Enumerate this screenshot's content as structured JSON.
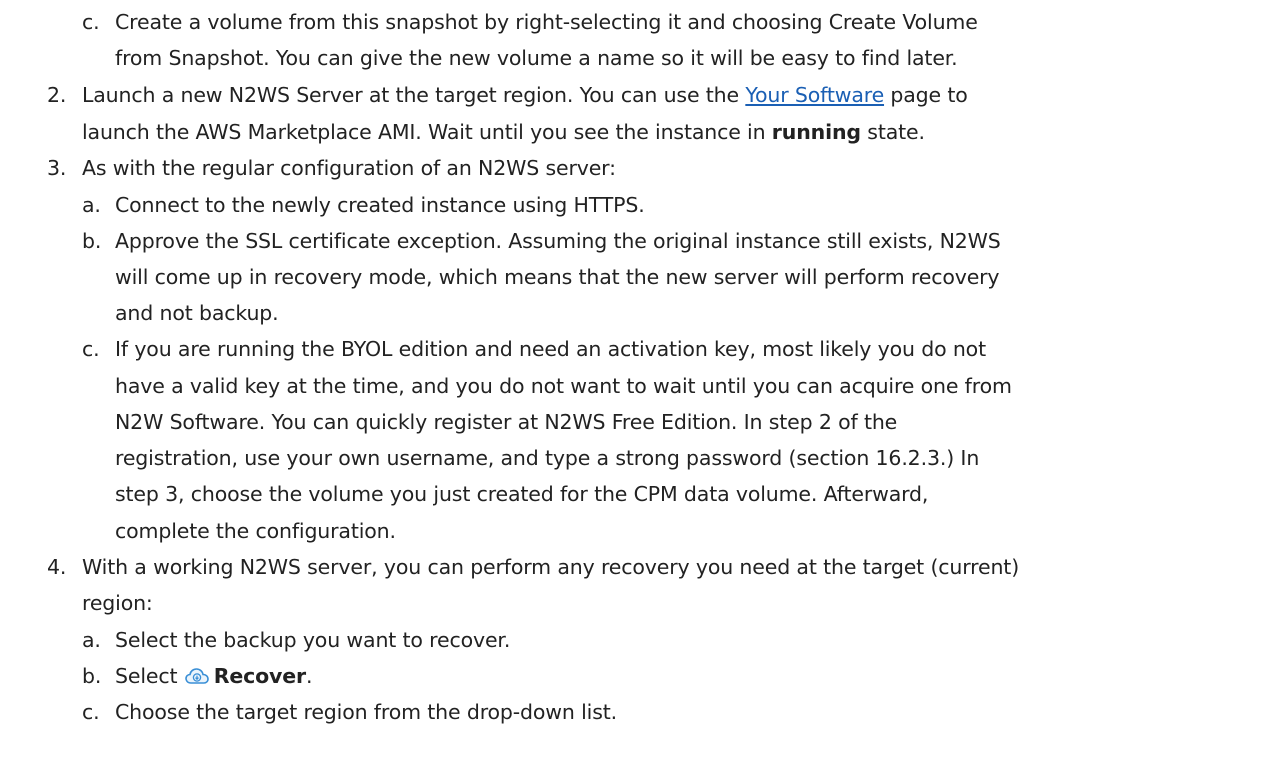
{
  "doc": {
    "item1c": {
      "marker": "c.",
      "line1": "Create a volume from this snapshot by right-selecting it and choosing Create Volume",
      "line2": "from Snapshot. You can give the new volume a name so it will be easy to find later."
    },
    "item2": {
      "marker": "2.",
      "line1_pre": "Launch a new N2WS Server at the target region. You can use the ",
      "link_text": "Your Software",
      "line1_post": " page to",
      "line2_pre": "launch the AWS Marketplace AMI. Wait until you see the instance in ",
      "line2_bold": "running",
      "line2_post": " state."
    },
    "item3": {
      "marker": "3.",
      "line1": "As with the regular configuration of an N2WS server:",
      "a_marker": "a.",
      "a_line1": "Connect to the newly created instance using HTTPS.",
      "b_marker": "b.",
      "b_line1": "Approve the SSL certificate exception. Assuming the original instance still exists, N2WS",
      "b_line2": "will come up in recovery mode, which means that the new server will perform recovery",
      "b_line3": "and not backup.",
      "c_marker": "c.",
      "c_line1": "If you are running the BYOL edition and need an activation key, most likely you do not",
      "c_line2": "have a valid key at the time, and you do not want to wait until you can acquire one from",
      "c_line3": "N2W Software. You can quickly register at N2WS Free Edition. In step 2 of the",
      "c_line4": "registration, use your own username, and type a strong password (section 16.2.3.) In",
      "c_line5": "step 3, choose the volume you just created for the CPM data volume. Afterward,",
      "c_line6": "complete the configuration."
    },
    "item4": {
      "marker": "4.",
      "line1": "With a working N2WS server, you can perform any recovery you need at the target (current)",
      "line2": "region:",
      "a_marker": "a.",
      "a_line1": "Select the backup you want to recover.",
      "b_marker": "b.",
      "b_pre": "Select ",
      "b_bold": "Recover",
      "b_post": ".",
      "c_marker": "c.",
      "c_line1": "Choose the target region from the drop-down list."
    },
    "icons": {
      "recover": "cloud-recover-icon"
    },
    "colors": {
      "link": "#1a5fb4",
      "text": "#222222",
      "icon": "#3a8fd6"
    }
  }
}
